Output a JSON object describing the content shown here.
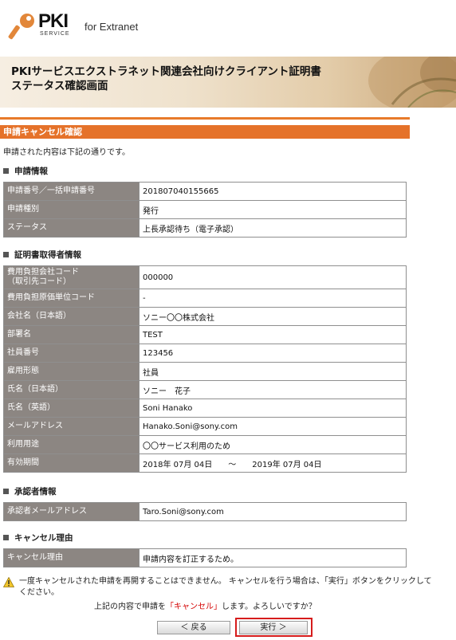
{
  "header": {
    "logo_main": "PKI",
    "logo_sub": "SERVICE",
    "subtitle": "for Extranet",
    "banner_line1": "PKIサービスエクストラネット関連会社向けクライアント証明書",
    "banner_line2": "ステータス確認画面"
  },
  "section": {
    "title": "申請キャンセル確認",
    "intro": "申請された内容は下記の通りです。"
  },
  "application": {
    "heading": "申請情報",
    "rows": [
      {
        "label": "申請番号／一括申請番号",
        "value": "201807040155665"
      },
      {
        "label": "申請種別",
        "value": "発行"
      },
      {
        "label": "ステータス",
        "value": "上長承認待ち（電子承認）"
      }
    ]
  },
  "holder": {
    "heading": "証明書取得者情報",
    "rows": [
      {
        "label": "費用負担会社コード\n（取引先コード）",
        "value": "000000"
      },
      {
        "label": "費用負担原価単位コード",
        "value": "-"
      },
      {
        "label": "会社名（日本語）",
        "value": "ソニー〇〇株式会社"
      },
      {
        "label": "部署名",
        "value": "TEST"
      },
      {
        "label": "社員番号",
        "value": "123456"
      },
      {
        "label": "雇用形態",
        "value": "社員"
      },
      {
        "label": "氏名（日本語）",
        "value": "ソニー　花子"
      },
      {
        "label": "氏名（英語）",
        "value": "Soni Hanako"
      },
      {
        "label": "メールアドレス",
        "value": "Hanako.Soni@sony.com"
      },
      {
        "label": "利用用途",
        "value": "〇〇サービス利用のため"
      },
      {
        "label": "有効期間",
        "value": "2018年 07月 04日　　～　　2019年 07月 04日"
      }
    ]
  },
  "approver": {
    "heading": "承認者情報",
    "rows": [
      {
        "label": "承認者メールアドレス",
        "value": "Taro.Soni@sony.com"
      }
    ]
  },
  "cancel": {
    "heading": "キャンセル理由",
    "rows": [
      {
        "label": "キャンセル理由",
        "value": "申請内容を訂正するため。"
      }
    ]
  },
  "warning": {
    "icon": "warning-icon",
    "text": "一度キャンセルされた申請を再開することはできません。 キャンセルを行う場合は、「実行」ボタンをクリックしてください。",
    "confirm_before": "上記の内容で申請を",
    "confirm_highlight": "「キャンセル」",
    "confirm_after": "します。よろしいですか？"
  },
  "buttons": {
    "back": "＜ 戻る",
    "execute": "実行 ＞"
  },
  "colors": {
    "accent": "#e5722a",
    "label_bg": "#8c8682",
    "highlight_border": "#d61c1c"
  }
}
